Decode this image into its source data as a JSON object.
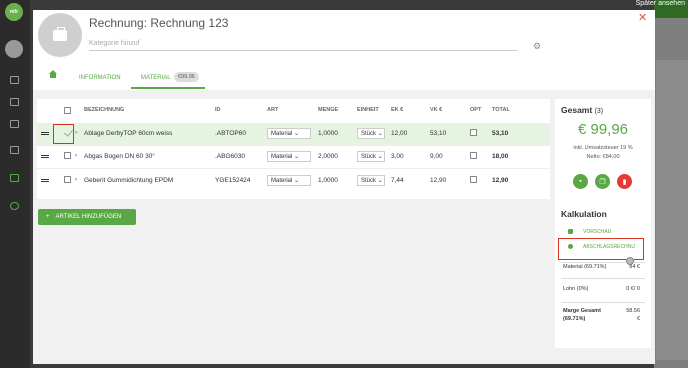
{
  "app": {
    "logo_text": "mfr"
  },
  "background_page": {
    "later_label": "Später ansehen"
  },
  "modal": {
    "title": "Rechnung: Rechnung 123",
    "category_placeholder": "Kategorie hinzuf",
    "tabs": [
      {
        "label": "INFORMATION"
      },
      {
        "label": "MATERIAL",
        "badge": "€99.96"
      }
    ]
  },
  "table": {
    "headers": [
      "BEZEICHNUNG",
      "ID",
      "ART",
      "MENGE",
      "EINHEIT",
      "EK €",
      "VK €",
      "OPT",
      "TOTAL"
    ],
    "rows": [
      {
        "name": "Ablage DerbyTOP 60cm weiss",
        "id": ".ABTOP60",
        "art": "Material",
        "menge": "1,0000",
        "einheit": "Stück",
        "ek": "12,00",
        "vk": "53,10",
        "total": "53,10",
        "highlighted": true
      },
      {
        "name": "Abgas Bogen DN 60 30°",
        "id": ".ABG6030",
        "art": "Material",
        "menge": "2,0000",
        "einheit": "Stück",
        "ek": "3,00",
        "vk": "9,00",
        "total": "18,00",
        "highlighted": false
      },
      {
        "name": "Geberit Gummidichtung EPDM",
        "id": "YGE152424",
        "art": "Material",
        "menge": "1,0000",
        "einheit": "Stück",
        "ek": "7,44",
        "vk": "12,90",
        "total": "12,90",
        "highlighted": false
      }
    ],
    "add_button": "ARTIKEL HINZUFÜGEN"
  },
  "summary": {
    "title": "Gesamt",
    "count": "(3)",
    "total": "€ 99,96",
    "vat_line": "inkl. Umsatzsteuer 19 %",
    "net_line": "Netto: €84,00",
    "colors": {
      "accent": "#58a846",
      "danger": "#e53935"
    }
  },
  "kalkulation": {
    "title": "Kalkulation",
    "links": [
      "VORSCHAU",
      "ABSCHLAGSRECHNU"
    ],
    "lines": [
      {
        "label": "Material (69.71%)",
        "value": "84 €"
      },
      {
        "label": "Lohn (0%)",
        "value": "0 €/ 0"
      },
      {
        "label": "Marge Gesamt",
        "label2": "(69.71%)",
        "value": "58.56",
        "value2": "€"
      }
    ]
  }
}
